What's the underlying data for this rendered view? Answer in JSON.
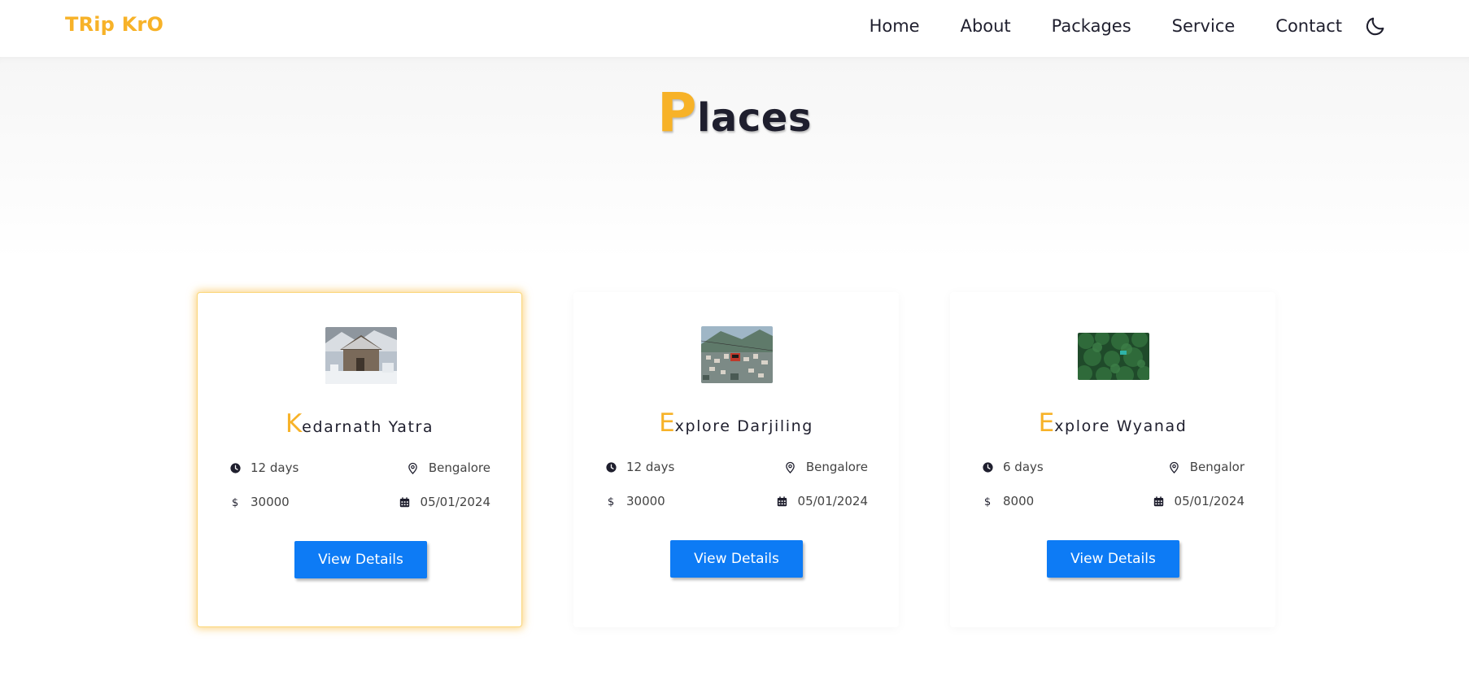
{
  "brand": "TRip KrO",
  "nav": {
    "links": [
      "Home",
      "About",
      "Packages",
      "Service",
      "Contact"
    ]
  },
  "section": {
    "title_first": "P",
    "title_rest": "laces"
  },
  "colors": {
    "accent": "#f7b228",
    "button": "#0d7bf5",
    "text": "#1f1f2e"
  },
  "cards": [
    {
      "title_first": "K",
      "title_rest": "edarnath Yatra",
      "duration": "12 days",
      "location": "Bengalore",
      "price": "30000",
      "date": "05/01/2024",
      "button": "View Details",
      "image": "snowy-temple-photo"
    },
    {
      "title_first": "E",
      "title_rest": "xplore Darjiling",
      "duration": "12 days",
      "location": "Bengalore",
      "price": "30000",
      "date": "05/01/2024",
      "button": "View Details",
      "image": "hill-town-cable-car-photo"
    },
    {
      "title_first": "E",
      "title_rest": "xplore Wyanad",
      "duration": "6 days",
      "location": "Bengalor",
      "price": "8000",
      "date": "05/01/2024",
      "button": "View Details",
      "image": "forest-canopy-photo"
    }
  ]
}
